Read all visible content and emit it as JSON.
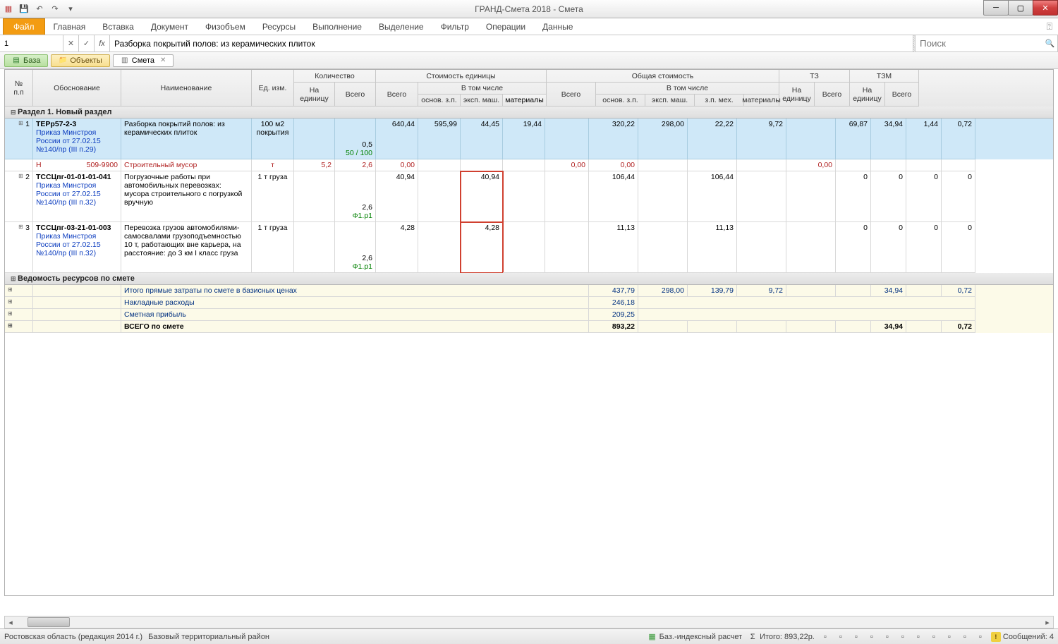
{
  "window": {
    "title": "ГРАНД-Смета 2018 - Смета"
  },
  "ribbon": {
    "file": "Файл",
    "tabs": [
      "Главная",
      "Вставка",
      "Документ",
      "Физобъем",
      "Ресурсы",
      "Выполнение",
      "Выделение",
      "Фильтр",
      "Операции",
      "Данные"
    ]
  },
  "formula": {
    "cell": "1",
    "fx": "fx",
    "value": "Разборка покрытий полов: из керамических плиток",
    "search_placeholder": "Поиск"
  },
  "doctabs": [
    {
      "label": "База",
      "kind": "green"
    },
    {
      "label": "Объекты",
      "kind": "yellow"
    },
    {
      "label": "Смета",
      "kind": "active",
      "closable": true
    }
  ],
  "columns": {
    "npp": "№\nп.п",
    "obos": "Обоснование",
    "name": "Наименование",
    "unit": "Ед. изм.",
    "qty": "Количество",
    "qty_unit": "На\nединицу",
    "qty_total": "Всего",
    "cost_unit": "Стоимость единицы",
    "total": "Всего",
    "incl": "В том числе",
    "osn": "основ. з.п.",
    "eksp": "эксп. маш.",
    "zpmex": "з.п. мех.",
    "mat": "материалы",
    "cost_total": "Общая стоимость",
    "tz": "ТЗ",
    "tzm": "ТЗМ"
  },
  "section1": "Раздел 1. Новый раздел",
  "rows": [
    {
      "n": "1",
      "code": "ТЕРр57-2-3",
      "order": "Приказ Минстроя России от 27.02.15 №140/пр (III п.29)",
      "name": "Разборка покрытий полов: из керамических плиток",
      "unit": "100 м2 покрытия",
      "qu": "0,5",
      "qu2": "50 / 100",
      "cu_total": "640,44",
      "cu_osn": "595,99",
      "cu_eksp": "44,45",
      "cu_zpmex": "19,44",
      "ct_total": "320,22",
      "ct_osn": "298,00",
      "ct_eksp": "22,22",
      "ct_zpmex": "9,72",
      "tz_u": "69,87",
      "tz_t": "34,94",
      "tzm_u": "1,44",
      "tzm_t": "0,72"
    },
    {
      "sub": true,
      "code_l": "Н",
      "code_r": "509-9900",
      "name": "Строительный мусор",
      "unit": "т",
      "qu": "5,2",
      "qt": "2,6",
      "cu_total": "0,00",
      "cu_mat": "0,00",
      "ct_total": "0,00",
      "ct_mat": "0,00"
    },
    {
      "n": "2",
      "code": "ТССЦпг-01-01-01-041",
      "order": "Приказ Минстроя России от 27.02.15 №140/пр (III п.32)",
      "name": "Погрузочные работы при автомобильных перевозках: мусора строительного с погрузкой вручную",
      "unit": "1 т груза",
      "qt": "2,6",
      "qt2": "Ф1.р1",
      "cu_total": "40,94",
      "cu_eksp": "40,94",
      "ct_total": "106,44",
      "ct_eksp": "106,44",
      "tz_u": "0",
      "tz_t": "0",
      "tzm_u": "0",
      "tzm_t": "0"
    },
    {
      "n": "3",
      "code": "ТССЦпг-03-21-01-003",
      "order": "Приказ Минстроя России от 27.02.15 №140/пр (III п.32)",
      "name": "Перевозка грузов автомобилями-самосвалами грузоподъемностью 10 т, работающих вне карьера, на расстояние: до 3 км I класс груза",
      "unit": "1 т груза",
      "qt": "2,6",
      "qt2": "Ф1.р1",
      "cu_total": "4,28",
      "cu_eksp": "4,28",
      "ct_total": "11,13",
      "ct_eksp": "11,13",
      "tz_u": "0",
      "tz_t": "0",
      "tzm_u": "0",
      "tzm_t": "0"
    }
  ],
  "section2": "Ведомость ресурсов по смете",
  "summary": [
    {
      "name": "Итого прямые затраты по смете в базисных ценах",
      "ct_total": "437,79",
      "ct_osn": "298,00",
      "ct_eksp": "139,79",
      "ct_zpmex": "9,72",
      "tz_t": "34,94",
      "tzm_t": "0,72"
    },
    {
      "name": "Накладные расходы",
      "ct_total": "246,18"
    },
    {
      "name": "Сметная прибыль",
      "ct_total": "209,25"
    }
  ],
  "grand": {
    "name": "ВСЕГО по смете",
    "ct_total": "893,22",
    "tz_t": "34,94",
    "tzm_t": "0,72"
  },
  "status": {
    "left1": "Ростовская область (редакция 2014 г.)",
    "left2": "Базовый территориальный район",
    "calc": "Баз.-индексный расчет",
    "sum": "Итого: 893,22р.",
    "msgs": "Сообщений: 4"
  }
}
